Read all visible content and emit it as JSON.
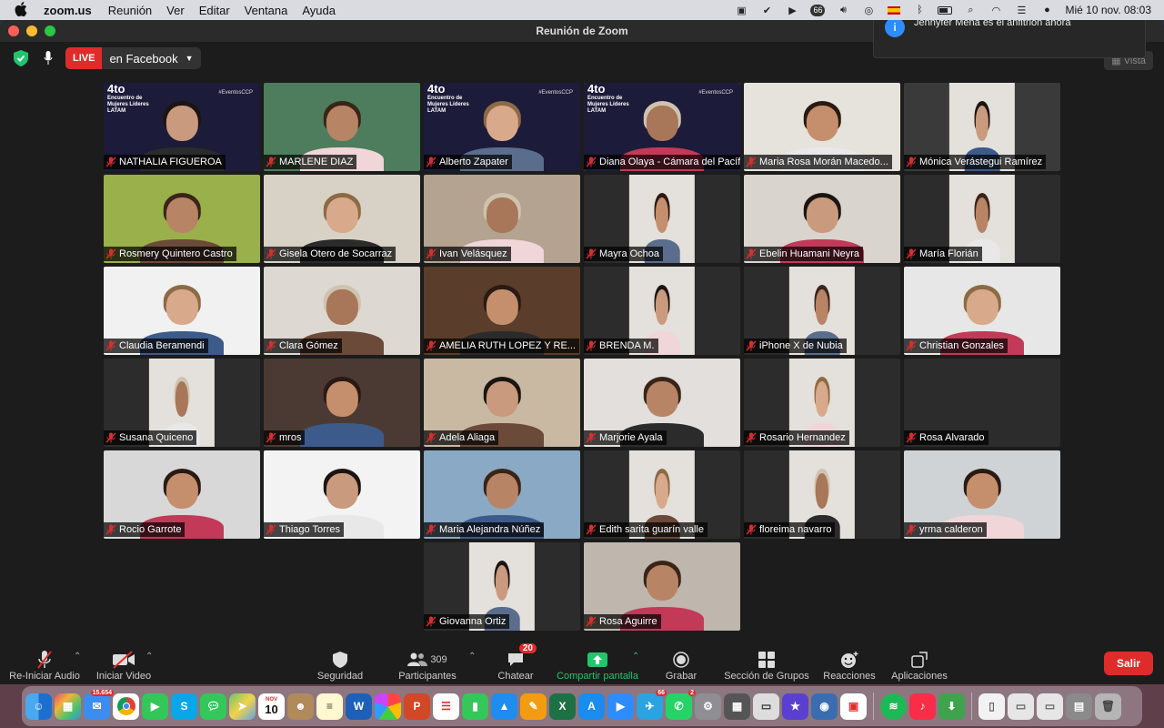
{
  "menubar": {
    "app_name": "zoom.us",
    "menus": [
      "Reunión",
      "Ver",
      "Editar",
      "Ventana",
      "Ayuda"
    ],
    "datetime": "Mié 10 nov.  08:03",
    "notifications_count": "66"
  },
  "window": {
    "title": "Reunión de Zoom",
    "live_label": "LIVE",
    "live_target": "en Facebook",
    "view_button": "Vista"
  },
  "notification": {
    "text": "Jennyfer Mena es el anfitrión ahora"
  },
  "event_overlay": {
    "line1": "4to",
    "line2": "Encuentro de",
    "line3": "Mujeres Líderes",
    "line4": "LATAM",
    "hashtag": "#EventosCCP"
  },
  "participants": [
    {
      "name": "NATHALIA FIGUEROA",
      "bg": "#1d1b3a",
      "event": true
    },
    {
      "name": "MARLENE DIAZ",
      "bg": "#4d7d5c"
    },
    {
      "name": "Alberto Zapater",
      "bg": "#1d1b3a",
      "event": true
    },
    {
      "name": "Diana Olaya - Cámara del Pacíf...",
      "bg": "#1d1b3a",
      "event": true,
      "active": true
    },
    {
      "name": "Maria Rosa Morán Macedo...",
      "bg": "#e6e2dc"
    },
    {
      "name": "Mónica Verástegui Ramírez",
      "bg": "#3a3a3a",
      "pillar": true
    },
    {
      "name": "Rosmery Quintero Castro",
      "bg": "#9ab04a"
    },
    {
      "name": "Gisela Otero de Socarraz",
      "bg": "#d8d2c6"
    },
    {
      "name": "Ivan Velásquez",
      "bg": "#b3a390"
    },
    {
      "name": "Mayra Ochoa",
      "bg": "#2c2c2c",
      "pillar": true
    },
    {
      "name": "Ebelin Huamani Neyra",
      "bg": "#d9d4cd"
    },
    {
      "name": "María Florián",
      "bg": "#2c2c2c",
      "pillar": true
    },
    {
      "name": "Claudia Beramendi",
      "bg": "#f1f1f1"
    },
    {
      "name": "Clara Gómez",
      "bg": "#ded8d2"
    },
    {
      "name": "AMELIA RUTH LOPEZ Y RE...",
      "bg": "#5a3d2a"
    },
    {
      "name": "BRENDA M.",
      "bg": "#2c2c2c",
      "pillar": true
    },
    {
      "name": "iPhone X de Nubia",
      "bg": "#2c2c2c",
      "pillar": true
    },
    {
      "name": "Christian Gonzales",
      "bg": "#e7e7e7"
    },
    {
      "name": "Susana Quiceno",
      "bg": "#2c2c2c",
      "pillar": true
    },
    {
      "name": "mros",
      "bg": "#4b3a33"
    },
    {
      "name": "Adela Aliaga",
      "bg": "#c9b8a2"
    },
    {
      "name": "Marjorie Ayala",
      "bg": "#e2dfdc"
    },
    {
      "name": "Rosario Hernandez",
      "bg": "#2c2c2c",
      "pillar": true
    },
    {
      "name": "Rosa Alvarado",
      "bg": "#2c2c2c",
      "empty": true
    },
    {
      "name": "Rocio Garrote",
      "bg": "#d8d8d8"
    },
    {
      "name": "Thiago Torres",
      "bg": "#f3f3f3"
    },
    {
      "name": "Maria Alejandra Núñez",
      "bg": "#8aa9c4"
    },
    {
      "name": "Edith sarita guarín valle",
      "bg": "#2c2c2c",
      "pillar": true
    },
    {
      "name": "floreima navarro",
      "bg": "#2c2c2c",
      "pillar": true
    },
    {
      "name": "yrma calderon",
      "bg": "#cfd3d6"
    },
    {
      "name": "Giovanna Ortiz",
      "bg": "#2c2c2c",
      "pillar": true
    },
    {
      "name": "Rosa Aguirre",
      "bg": "#bfb6ae"
    }
  ],
  "toolbar": {
    "audio": "Re-Iniciar Audio",
    "video": "Iniciar Video",
    "security": "Seguridad",
    "participants": "Participantes",
    "participants_count": "309",
    "chat": "Chatear",
    "chat_badge": "20",
    "share": "Compartir pantalla",
    "record": "Grabar",
    "breakout": "Sección de Grupos",
    "reactions": "Reacciones",
    "apps": "Aplicaciones",
    "leave": "Salir"
  },
  "dock": {
    "mail_badge": "15.654",
    "calendar_month": "NOV",
    "calendar_day": "10",
    "telegram_badge": "66",
    "whatsapp_badge": "2"
  }
}
